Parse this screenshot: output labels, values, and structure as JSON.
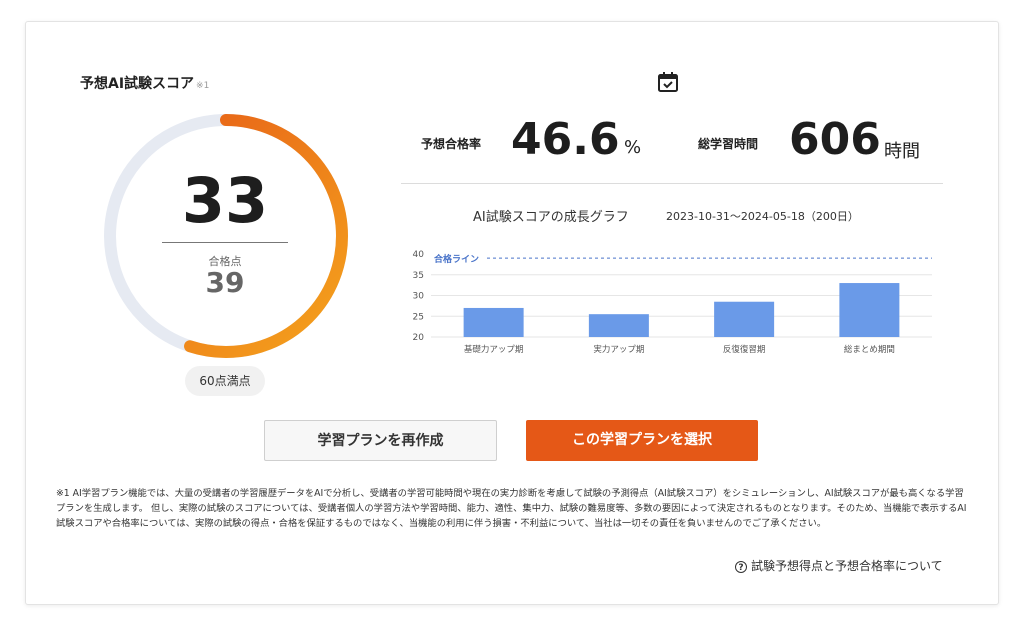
{
  "score": {
    "title": "予想AI試験スコア",
    "title_note": "※1",
    "value": "33",
    "pass_label": "合格点",
    "pass_value": "39",
    "max_label": "60点満点",
    "progress_fraction": 0.55,
    "track_color": "#e6eaf2",
    "arc_color_start": "#f5a41d",
    "arc_color_end": "#e55817"
  },
  "stats": {
    "pass_rate_label": "予想合格率",
    "pass_rate_value": "46.6",
    "pass_rate_unit": "%",
    "study_time_label": "総学習時間",
    "study_time_value": "606",
    "study_time_unit": "時間",
    "calendar_icon": "calendar-check-icon"
  },
  "graph": {
    "title": "AI試験スコアの成長グラフ",
    "range": "2023-10-31～2024-05-18（200日）"
  },
  "chart_data": {
    "type": "bar",
    "categories": [
      "基礎力アップ期",
      "実力アップ期",
      "反復復習期",
      "総まとめ期間"
    ],
    "values": [
      27,
      25.5,
      28.5,
      33
    ],
    "yticks": [
      "40",
      "35",
      "30",
      "25",
      "20"
    ],
    "ylim": [
      20,
      40
    ],
    "pass_line_label": "合格ライン",
    "pass_line_value": 39,
    "bar_color": "#6a9ae8",
    "pass_line_color": "#4a74c9",
    "grid": true
  },
  "buttons": {
    "recreate": "学習プランを再作成",
    "select": "この学習プランを選択",
    "select_color": "#e55817"
  },
  "footnote": "※1 AI学習プラン機能では、大量の受講者の学習履歴データをAIで分析し、受講者の学習可能時間や現在の実力診断を考慮して試験の予測得点（AI試験スコア）をシミュレーションし、AI試験スコアが最も高くなる学習プランを生成します。 但し、実際の試験のスコアについては、受講者個人の学習方法や学習時間、能力、適性、集中力、試験の難易度等、多数の要因によって決定されるものとなります。そのため、当機能で表示するAI試験スコアや合格率については、実際の試験の得点・合格を保証するものではなく、当機能の利用に伴う損害・不利益について、当社は一切その責任を負いませんのでご了承ください。",
  "about_link": {
    "label": "試験予想得点と予想合格率について",
    "icon": "question-circle-icon"
  }
}
